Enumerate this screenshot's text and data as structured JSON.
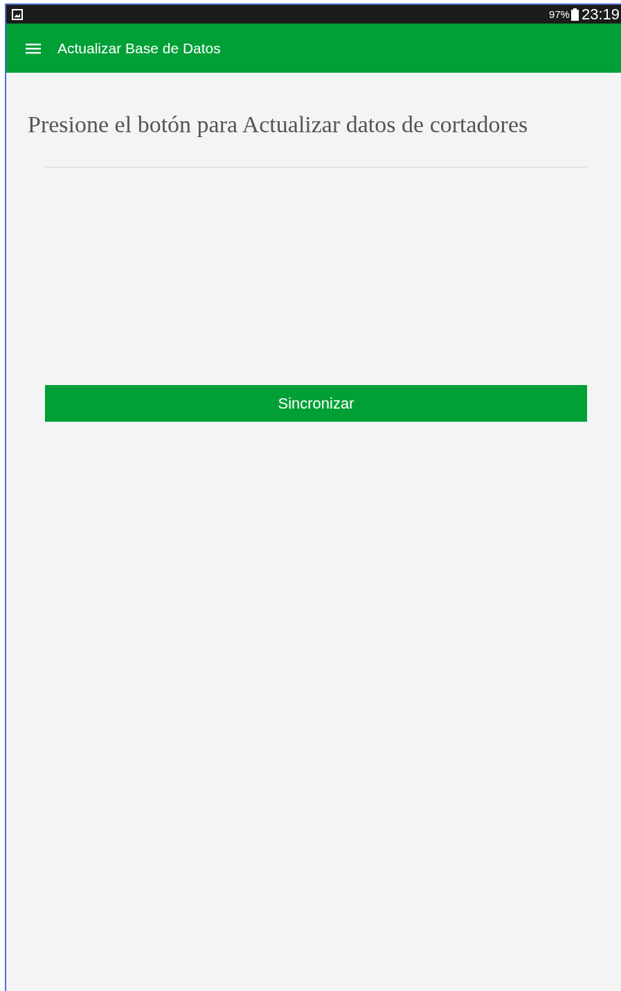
{
  "status_bar": {
    "battery": "97%",
    "time": "23:19"
  },
  "app_bar": {
    "title": "Actualizar Base de Datos"
  },
  "content": {
    "heading": "Presione el botón para Actualizar datos de cortadores",
    "button": "Sincronizar"
  }
}
